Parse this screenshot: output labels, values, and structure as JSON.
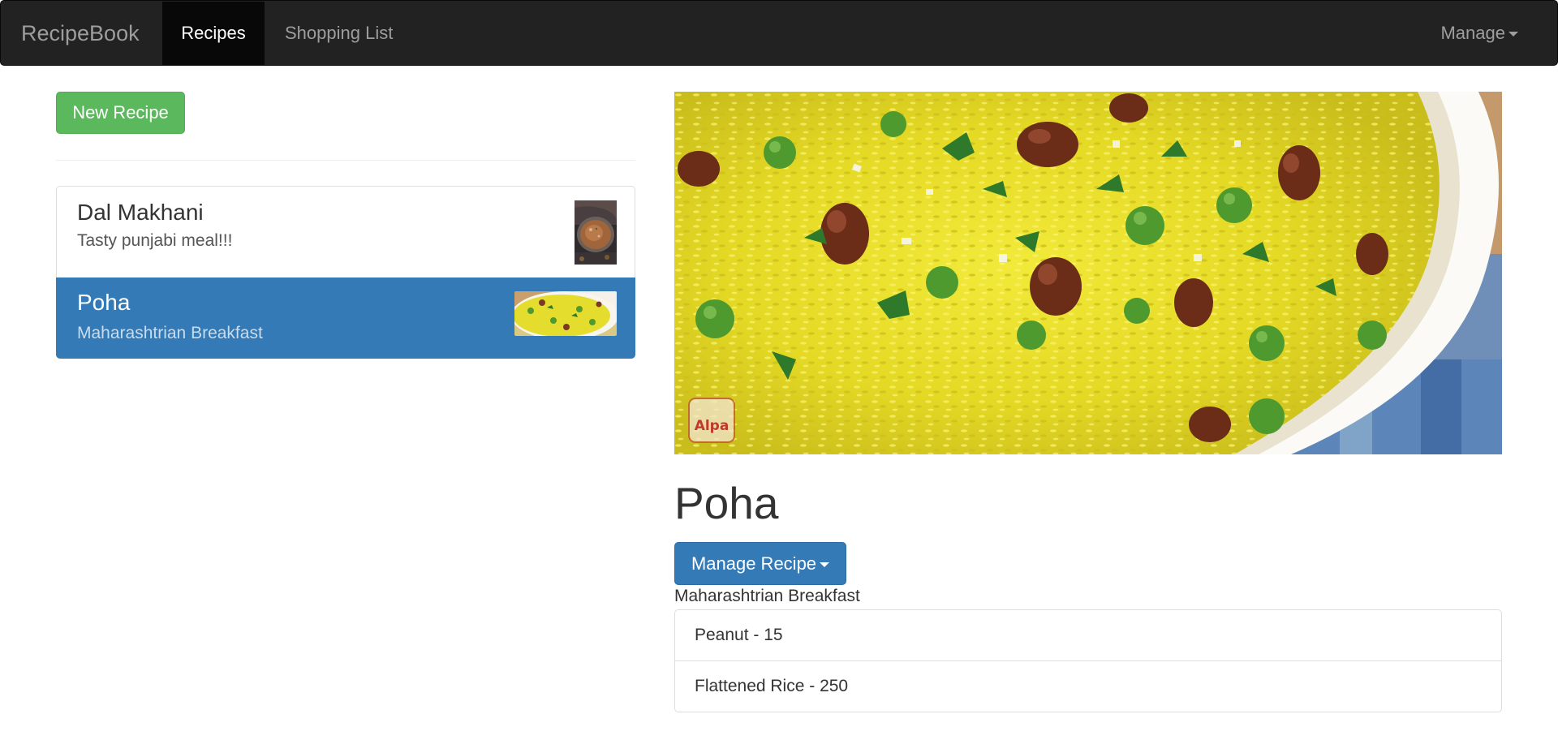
{
  "navbar": {
    "brand": "RecipeBook",
    "tabs": [
      {
        "label": "Recipes",
        "active": true
      },
      {
        "label": "Shopping List",
        "active": false
      }
    ],
    "manage_label": "Manage"
  },
  "sidebar": {
    "new_recipe_label": "New Recipe",
    "recipes": [
      {
        "name": "Dal Makhani",
        "description": "Tasty punjabi meal!!!",
        "active": false
      },
      {
        "name": "Poha",
        "description": "Maharashtrian Breakfast",
        "active": true
      }
    ]
  },
  "detail": {
    "title": "Poha",
    "manage_button_label": "Manage Recipe",
    "description": "Maharashtrian Breakfast",
    "image_watermark": "Alpa",
    "ingredients": [
      "Peanut - 15",
      "Flattened Rice - 250"
    ]
  },
  "colors": {
    "navbar_bg": "#222222",
    "active_tab_bg": "#080808",
    "success_green": "#5cb85c",
    "primary_blue": "#337ab7"
  }
}
